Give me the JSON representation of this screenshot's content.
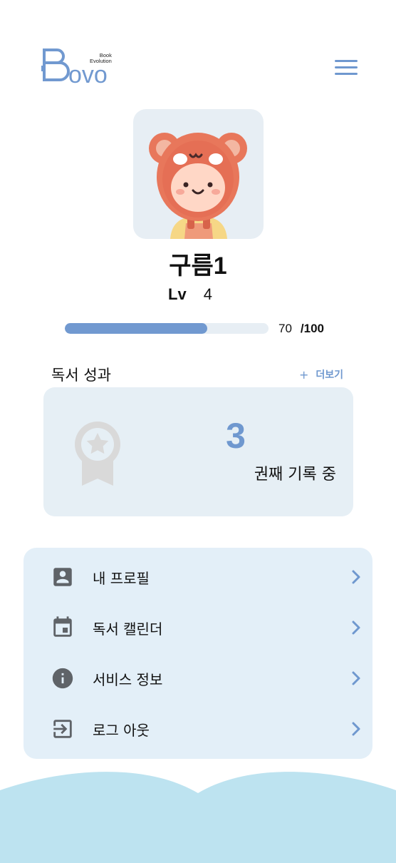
{
  "header": {
    "logo_text": "Bovo",
    "logo_tag_line1": "Book",
    "logo_tag_line2": "Evolution"
  },
  "profile": {
    "name": "구름1",
    "level_label": "Lv",
    "level_value": "4",
    "xp_current": "70",
    "xp_max": "/100",
    "xp_fraction": 0.7
  },
  "achievements": {
    "title": "독서 성과",
    "more_plus": "+",
    "more_label": "더보기",
    "count": "3",
    "count_label": "권째 기록 중"
  },
  "menu": {
    "items": [
      {
        "label": "내 프로필",
        "icon": "account-box-icon"
      },
      {
        "label": "독서 캘린더",
        "icon": "calendar-icon"
      },
      {
        "label": "서비스 정보",
        "icon": "info-icon"
      },
      {
        "label": "로그 아웃",
        "icon": "logout-icon"
      }
    ]
  },
  "colors": {
    "accent": "#6f98cf",
    "card_bg": "#e6eff5",
    "menu_bg": "#e3eff8",
    "wave": "#bde3f0",
    "icon_gray": "#5f6368"
  }
}
